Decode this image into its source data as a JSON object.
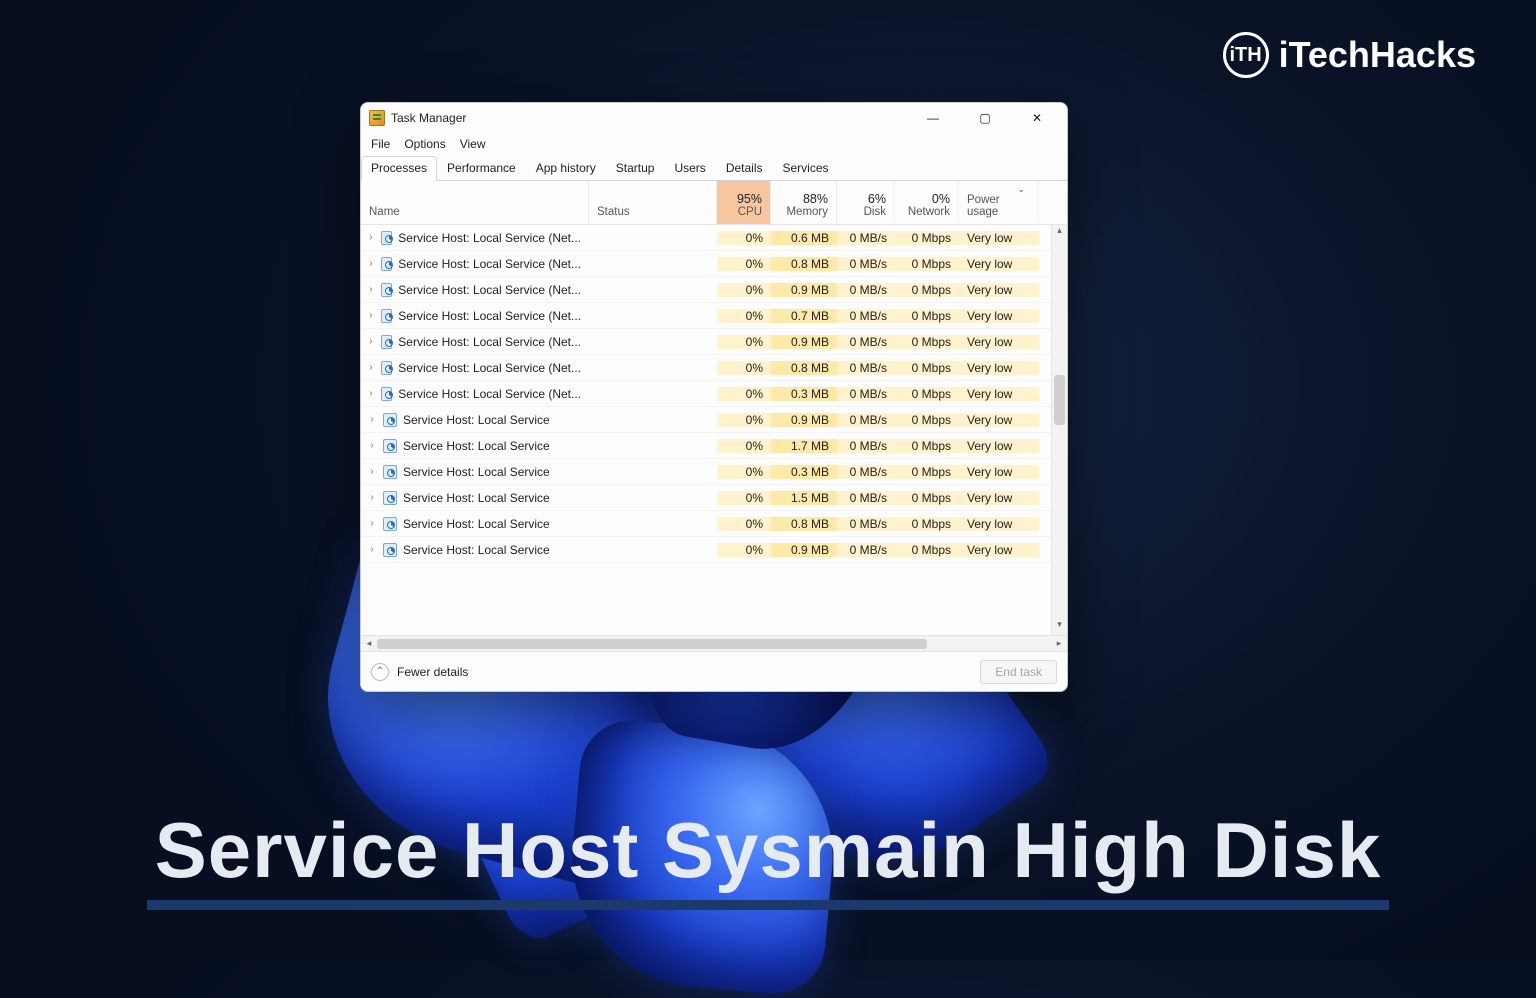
{
  "brand": {
    "badge": "iTH",
    "name": "iTechHacks"
  },
  "banner": {
    "text": "Service Host Sysmain High Disk"
  },
  "window": {
    "title": "Task Manager",
    "controls": {
      "min": "—",
      "max": "▢",
      "close": "✕"
    },
    "menu": [
      "File",
      "Options",
      "View"
    ],
    "tabs": [
      "Processes",
      "Performance",
      "App history",
      "Startup",
      "Users",
      "Details",
      "Services"
    ],
    "active_tab": 0,
    "columns": {
      "name": "Name",
      "status": "Status",
      "cpu": {
        "pct": "95%",
        "label": "CPU"
      },
      "mem": {
        "pct": "88%",
        "label": "Memory"
      },
      "disk": {
        "pct": "6%",
        "label": "Disk"
      },
      "net": {
        "pct": "0%",
        "label": "Network"
      },
      "power": "Power usage"
    },
    "rows": [
      {
        "name": "Service Host: Local Service (Net...",
        "cpu": "0%",
        "mem": "0.6 MB",
        "disk": "0 MB/s",
        "net": "0 Mbps",
        "power": "Very low"
      },
      {
        "name": "Service Host: Local Service (Net...",
        "cpu": "0%",
        "mem": "0.8 MB",
        "disk": "0 MB/s",
        "net": "0 Mbps",
        "power": "Very low"
      },
      {
        "name": "Service Host: Local Service (Net...",
        "cpu": "0%",
        "mem": "0.9 MB",
        "disk": "0 MB/s",
        "net": "0 Mbps",
        "power": "Very low"
      },
      {
        "name": "Service Host: Local Service (Net...",
        "cpu": "0%",
        "mem": "0.7 MB",
        "disk": "0 MB/s",
        "net": "0 Mbps",
        "power": "Very low"
      },
      {
        "name": "Service Host: Local Service (Net...",
        "cpu": "0%",
        "mem": "0.9 MB",
        "disk": "0 MB/s",
        "net": "0 Mbps",
        "power": "Very low"
      },
      {
        "name": "Service Host: Local Service (Net...",
        "cpu": "0%",
        "mem": "0.8 MB",
        "disk": "0 MB/s",
        "net": "0 Mbps",
        "power": "Very low"
      },
      {
        "name": "Service Host: Local Service (Net...",
        "cpu": "0%",
        "mem": "0.3 MB",
        "disk": "0 MB/s",
        "net": "0 Mbps",
        "power": "Very low"
      },
      {
        "name": "Service Host: Local Service",
        "cpu": "0%",
        "mem": "0.9 MB",
        "disk": "0 MB/s",
        "net": "0 Mbps",
        "power": "Very low"
      },
      {
        "name": "Service Host: Local Service",
        "cpu": "0%",
        "mem": "1.7 MB",
        "disk": "0 MB/s",
        "net": "0 Mbps",
        "power": "Very low"
      },
      {
        "name": "Service Host: Local Service",
        "cpu": "0%",
        "mem": "0.3 MB",
        "disk": "0 MB/s",
        "net": "0 Mbps",
        "power": "Very low"
      },
      {
        "name": "Service Host: Local Service",
        "cpu": "0%",
        "mem": "1.5 MB",
        "disk": "0 MB/s",
        "net": "0 Mbps",
        "power": "Very low"
      },
      {
        "name": "Service Host: Local Service",
        "cpu": "0%",
        "mem": "0.8 MB",
        "disk": "0 MB/s",
        "net": "0 Mbps",
        "power": "Very low"
      },
      {
        "name": "Service Host: Local Service",
        "cpu": "0%",
        "mem": "0.9 MB",
        "disk": "0 MB/s",
        "net": "0 Mbps",
        "power": "Very low"
      }
    ],
    "footer": {
      "fewer": "Fewer details",
      "end_task": "End task"
    }
  }
}
